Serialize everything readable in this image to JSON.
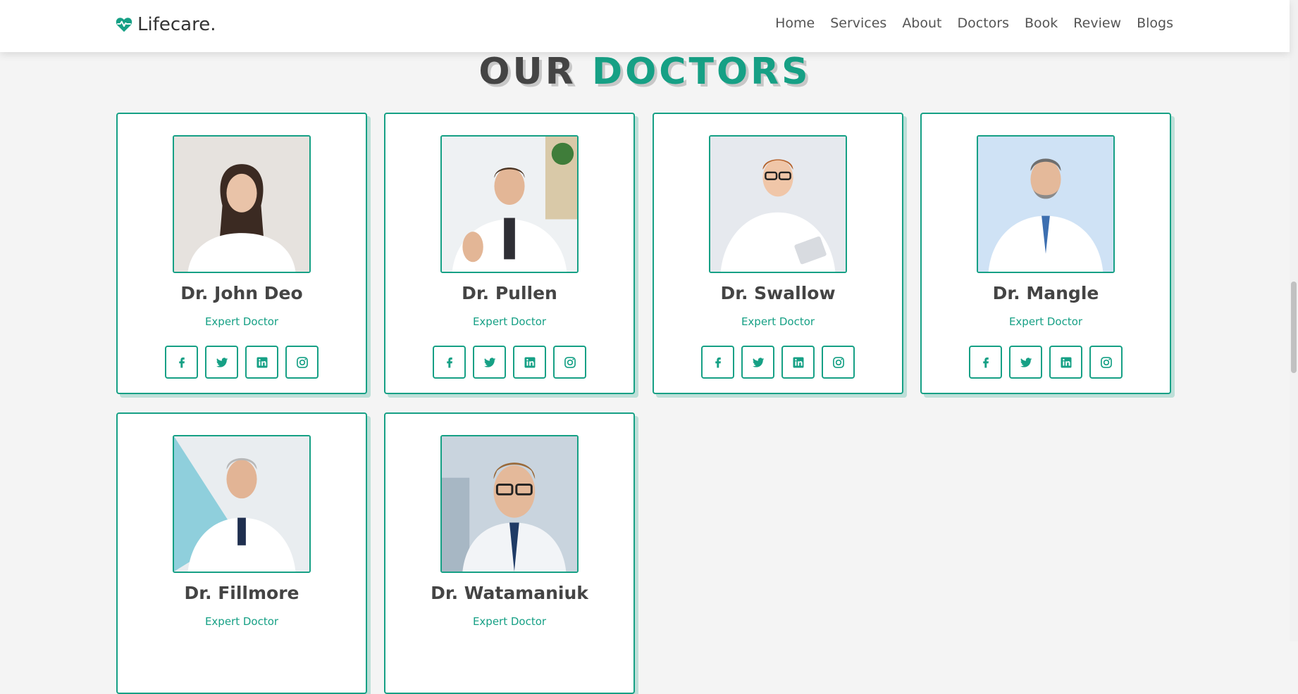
{
  "brand": {
    "name": "Lifecare.",
    "accent": "#16a085"
  },
  "nav": [
    "Home",
    "Services",
    "About",
    "Doctors",
    "Book",
    "Review",
    "Blogs"
  ],
  "section": {
    "title_part1": "OUR",
    "title_part2": "DOCTORS"
  },
  "doctors": [
    {
      "name": "Dr. John Deo",
      "role": "Expert Doctor"
    },
    {
      "name": "Dr. Pullen",
      "role": "Expert Doctor"
    },
    {
      "name": "Dr. Swallow",
      "role": "Expert Doctor"
    },
    {
      "name": "Dr. Mangle",
      "role": "Expert Doctor"
    },
    {
      "name": "Dr. Fillmore",
      "role": "Expert Doctor"
    },
    {
      "name": "Dr. Watamaniuk",
      "role": "Expert Doctor"
    }
  ],
  "social_icons": [
    "facebook-icon",
    "twitter-icon",
    "linkedin-icon",
    "instagram-icon"
  ]
}
